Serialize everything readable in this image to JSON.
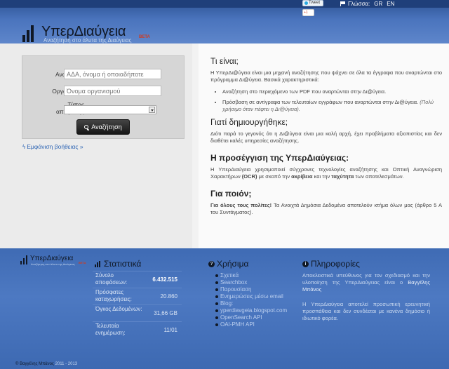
{
  "topbar": {
    "tweet_label": "Tweet",
    "gplus_label": "+1",
    "language_label": "Γλώσσα:",
    "lang_gr": "GR",
    "lang_en": "EN"
  },
  "logo": {
    "title": "ΥπερΔιαύγεια",
    "beta": "BETA",
    "subtitle": "Αναζήτηση στο άλυτα της Διαύγειας"
  },
  "search": {
    "label_search": "Αναζήτηση",
    "search_placeholder": "ΑΔΑ, όνομα ή οποιαδήποτε",
    "label_org": "Οργανισμός",
    "org_placeholder": "Όνομα οργανισμού",
    "label_type_1": "Τύπος",
    "label_type_2": "απόφασης",
    "type_value": "",
    "button_label": "Αναζήτηση"
  },
  "help_link": "Εμφάνιση βοήθειας »",
  "content": {
    "what_title": "Τι είναι;",
    "what_text": "Η ΥπερΔι@ύγεια είναι μια μηχανή αναζήτησης που ψάχνει σε όλα τα έγγραφα που αναρτώνται στο πρόγραμμα Δι@ύγεια. Βασικά χαρακτηριστικά:",
    "feature_1": "Αναζήτηση στο περιεχόμενο των PDF που αναρτώνται στην Δι@ύγεια.",
    "feature_2_main": "Πρόσβαση σε αντίγραφα των τελευταίων εγγράφων που αναρτώνται στην Δι@ύγεια.",
    "feature_2_note": "(Πολύ χρήσιμο όταν πέφτει η Δι@ύγεια).",
    "why_title": "Γιατί δημιουργήθηκε;",
    "why_text": "Διότι παρά το γεγονός ότι η Δι@ύγεια είναι μια καλή αρχή, έχει προβλήματα αξιοπιστίας και δεν διαθέτει καλές υπηρεσίες αναζήτησης.",
    "approach_title": "Η προσέγγιση της ΥπερΔιαύγειας:",
    "approach_pre": "Η ΥπερΔιαύγεια χρησιμοποιεί σύγχρονες τεχνολογίες αναζήτησης και Οπτική Αναγνώριση Χαρακτήρων",
    "approach_ocr": "(OCR)",
    "approach_mid": "με σκοπό την",
    "approach_accuracy": "ακρίβεια",
    "approach_and": "και την",
    "approach_speed": "ταχύτητα",
    "approach_post": "των αποτελεσμάτων.",
    "who_title": "Για ποιόν;",
    "who_bold": "Για όλους τους πολίτες!",
    "who_text": "Τα Ανοιχτά Δημόσια Δεδομένα αποτελούν κτήμα όλων μας (άρθρο 5 Α του Συντάγματος)."
  },
  "footer": {
    "logo_title": "ΥπερΔιαύγεια",
    "logo_beta": "BETA",
    "logo_sub": "Αναζήτηση στο άλυτα της Διαύγειας",
    "stats_title": "Στατιστικά",
    "stats": [
      {
        "label": "Σύνολο αποφάσεων:",
        "value": "6.432.515"
      },
      {
        "label": "Πρόσφατες καταχωρήσεις:",
        "value": "20.860"
      },
      {
        "label": "Όγκος Δεδομένων:",
        "value": "31,66 GB"
      },
      {
        "label": "Τελευταία ενημέρωση:",
        "value": "11/01"
      }
    ],
    "help_title": "Χρήσιμα",
    "help_links": [
      "Σχετικά",
      "Searchbox",
      "Παρουσίαση",
      "Ενημερώσεις μέσω email",
      "Blog:",
      "yperdiavgeia.blogspot.com",
      "OpenSearch API",
      "OAI-PMH API"
    ],
    "info_title": "Πληροφορίες",
    "info_p1_pre": "Αποκλειστικά υπεύθυνος για τον σχεδιασμό και την υλοποίηση της ΥπερΔιαύγειας είναι ο",
    "info_p1_name": "Βαγγέλης Μπάνος",
    "info_p2": "Η ΥπερΔιαύγεια αποτελεί προσωπική ερευνητική προσπάθεια και δεν συνδέεται με κανένα δημόσιο ή ιδιωτικό φορέα.",
    "copyright_name": "© Βαγγέλης Μπάνος",
    "copyright_years": "2011 - 2013"
  }
}
